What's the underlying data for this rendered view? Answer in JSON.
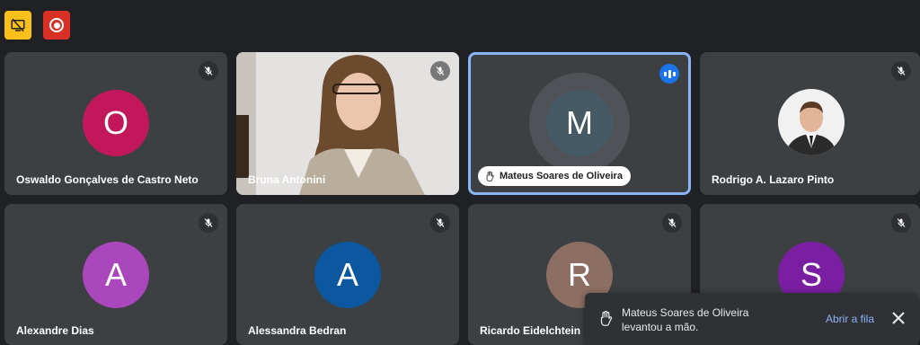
{
  "topbar": {
    "screen_icon": "screen-share-off-icon",
    "record_icon": "record-icon"
  },
  "tiles": [
    {
      "name": "Oswaldo Gonçalves de Castro Neto",
      "initial": "O",
      "color": "#c2185b",
      "mic": "mic-off"
    },
    {
      "name": "Bruna Antonini",
      "initial": "",
      "color": "",
      "mic": "mic-off",
      "video": true
    },
    {
      "name": "Mateus Soares de Oliveira",
      "initial": "M",
      "color": "#455a64",
      "mic": "speaking",
      "hand_raised": true
    },
    {
      "name": "Rodrigo A. Lazaro Pinto",
      "initial": "",
      "color": "",
      "mic": "mic-off",
      "photo": true
    },
    {
      "name": "Alexandre Dias",
      "initial": "A",
      "color": "#ab47bc",
      "mic": "mic-off"
    },
    {
      "name": "Alessandra Bedran",
      "initial": "A",
      "color": "#0b57a0",
      "mic": "mic-off"
    },
    {
      "name": "Ricardo Eidelchtein",
      "initial": "R",
      "color": "#8d6e63",
      "mic": "mic-off"
    },
    {
      "name": "",
      "initial": "S",
      "color": "#7b1fa2",
      "mic": "mic-off"
    }
  ],
  "toast": {
    "message": "Mateus Soares de Oliveira levantou a mão.",
    "action": "Abrir a fila",
    "hand_icon": "raised-hand-icon",
    "close_icon": "close-icon"
  }
}
